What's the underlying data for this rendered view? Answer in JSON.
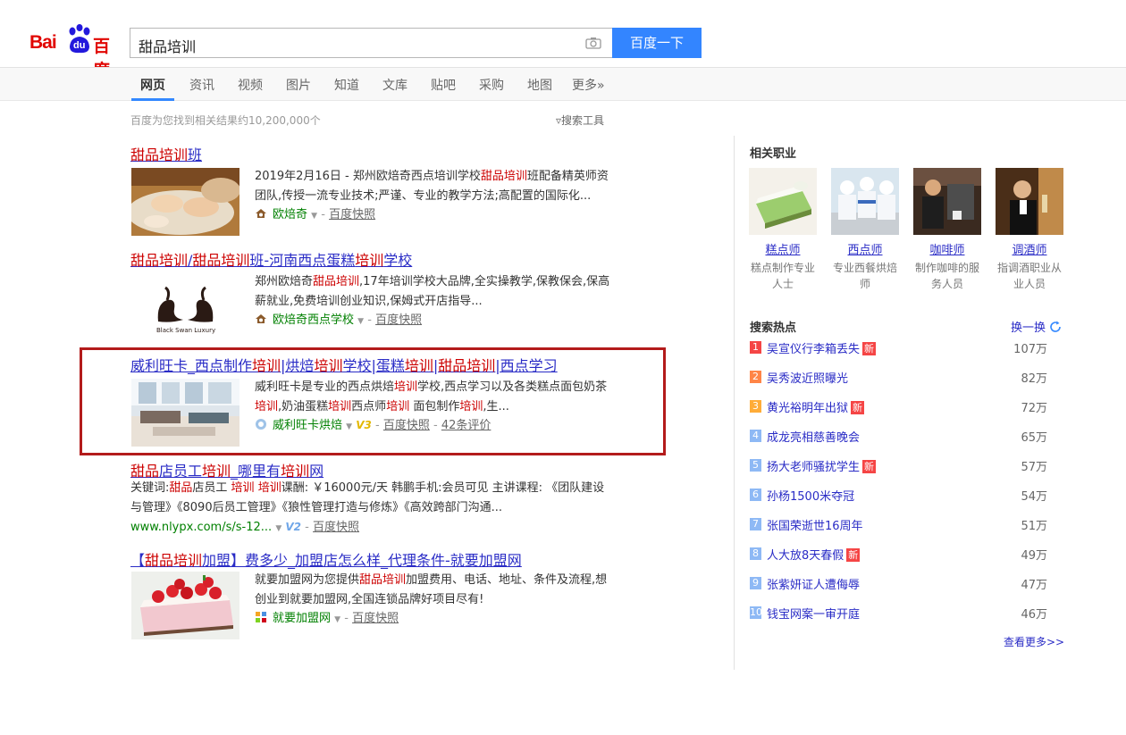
{
  "logo": {
    "bai": "Bai",
    "du": "du",
    "cn": "百度"
  },
  "search": {
    "query": "甜品培训",
    "button": "百度一下"
  },
  "nav": {
    "items": [
      "网页",
      "资讯",
      "视频",
      "图片",
      "知道",
      "文库",
      "贴吧",
      "采购",
      "地图",
      "更多»"
    ]
  },
  "stats": {
    "count_text": "百度为您找到相关结果约10,200,000个",
    "tools": "搜索工具"
  },
  "results": [
    {
      "title": [
        "甜品培训",
        "班"
      ],
      "abstract": [
        "2019年2月16日 - 郑州欧焙奇西点培训学校",
        "甜品培训",
        "班配备精英师资团队,传授一流专业技术;严谨、专业的教学方法;高配置的国际化..."
      ],
      "source": "欧焙奇",
      "snapshot": "百度快照"
    },
    {
      "title": [
        "甜品培训",
        "/",
        "甜品培训",
        "班-河南西点蛋糕",
        "培训",
        "学校"
      ],
      "thumb_text": "Black Swan Luxury",
      "abstract": [
        "郑州欧焙奇",
        "甜品培训",
        ",17年培训学校大品牌,全实操教学,保教保会,保高薪就业,免费培训创业知识,保姆式开店指导..."
      ],
      "source": "欧焙奇西点学校",
      "snapshot": "百度快照"
    },
    {
      "title": [
        "威利旺卡_西点制作",
        "培训",
        "|烘焙",
        "培训",
        "学校|蛋糕",
        "培训",
        "|",
        "甜品培训",
        "|西点学习"
      ],
      "abstract": [
        "威利旺卡是专业的西点烘焙",
        "培训",
        "学校,西点学习以及各类糕点面包奶茶",
        "培训",
        ",奶油蛋糕",
        "培训",
        "西点师",
        "培训",
        " 面包制作",
        "培训",
        ",生..."
      ],
      "source": "威利旺卡烘焙",
      "badge": "V3",
      "snapshot": "百度快照",
      "reviews": "42条评价"
    },
    {
      "title": [
        "甜品",
        "店员工",
        "培训",
        "_哪里有",
        "培训",
        "网"
      ],
      "abstract": [
        "关键词:",
        "甜品",
        "店员工 ",
        "培训",
        " ",
        "培训",
        "课酬: ￥16000元/天 韩鹏手机:会员可见 主讲课程: 《团队建设与管理》《8090后员工管理》《狼性管理打造与修炼》《高效跨部门沟通..."
      ],
      "url": "www.nlypx.com/s/s-12...",
      "badge": "V2",
      "snapshot": "百度快照"
    },
    {
      "title": [
        "【",
        "甜品培训",
        "加盟】费多少_加盟店怎么样_代理条件-就要加盟网"
      ],
      "abstract": [
        "就要加盟网为您提供",
        "甜品培训",
        "加盟费用、电话、地址、条件及流程,想创业到就要加盟网,全国连锁品牌好项目尽有!"
      ],
      "source": "就要加盟网",
      "snapshot": "百度快照"
    }
  ],
  "sidebar": {
    "jobs_heading": "相关职业",
    "jobs": [
      {
        "name": "糕点师",
        "desc": "糕点制作专业人士"
      },
      {
        "name": "西点师",
        "desc": "专业西餐烘焙师"
      },
      {
        "name": "咖啡师",
        "desc": "制作咖啡的服务人员"
      },
      {
        "name": "调酒师",
        "desc": "指调酒职业从业人员"
      }
    ],
    "hot_heading": "搜索热点",
    "refresh": "换一换",
    "hot": [
      {
        "rank": "1",
        "title": "吴宣仪行李箱丢失",
        "new": true,
        "count": "107万"
      },
      {
        "rank": "2",
        "title": "吴秀波近照曝光",
        "new": false,
        "count": "82万"
      },
      {
        "rank": "3",
        "title": "黄光裕明年出狱",
        "new": true,
        "count": "72万"
      },
      {
        "rank": "4",
        "title": "成龙亮相慈善晚会",
        "new": false,
        "count": "65万"
      },
      {
        "rank": "5",
        "title": "扬大老师骚扰学生",
        "new": true,
        "count": "57万"
      },
      {
        "rank": "6",
        "title": "孙杨1500米夺冠",
        "new": false,
        "count": "54万"
      },
      {
        "rank": "7",
        "title": "张国荣逝世16周年",
        "new": false,
        "count": "51万"
      },
      {
        "rank": "8",
        "title": "人大放8天春假",
        "new": true,
        "count": "49万"
      },
      {
        "rank": "9",
        "title": "张紫妍证人遭侮辱",
        "new": false,
        "count": "47万"
      },
      {
        "rank": "10",
        "title": "钱宝网案一审开庭",
        "new": false,
        "count": "46万"
      }
    ],
    "new_label": "新",
    "more": "查看更多>>"
  },
  "colors": {
    "rank_top1": "#f54545",
    "rank_top2": "#ff8547",
    "rank_top3": "#ffac38",
    "rank_other": "#8eb9f5",
    "highlight_border": "#b31b1b",
    "link": "#2a2cc6",
    "em": "#cc0000"
  }
}
